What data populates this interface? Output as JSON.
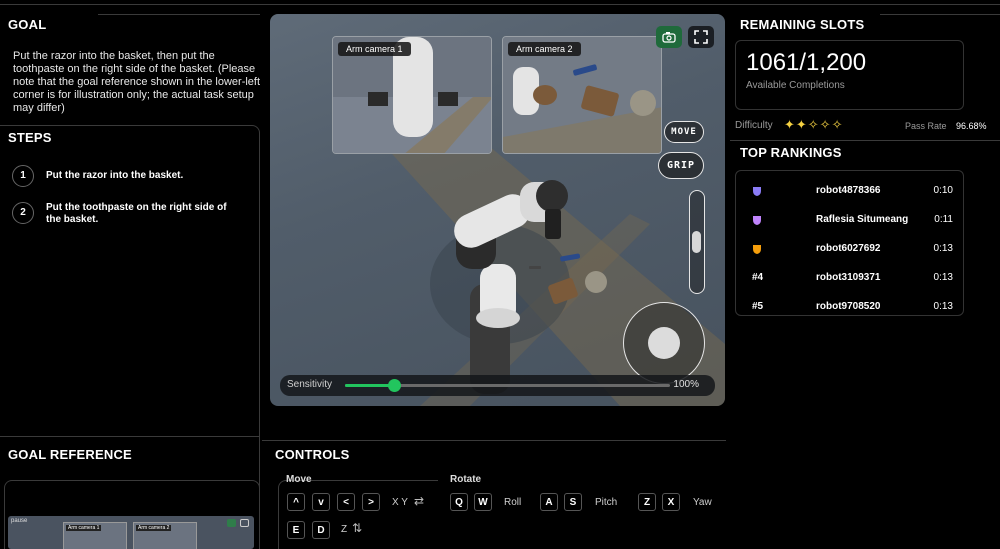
{
  "goal": {
    "heading": "GOAL",
    "text": "Put the razor into the basket, then put the toothpaste on the right side of the basket. (Please note that the goal reference shown in the lower-left corner is for illustration only; the actual task setup may differ)"
  },
  "steps": {
    "heading": "STEPS",
    "items": [
      {
        "num": "1",
        "text": "Put the razor into the basket."
      },
      {
        "num": "2",
        "text": "Put the toothpaste on the right side of the basket."
      }
    ]
  },
  "goal_reference": {
    "heading": "GOAL REFERENCE",
    "thumb_pause": "pause",
    "thumb_cam1": "Arm camera 1",
    "thumb_cam2": "Arm camera 2"
  },
  "viewport": {
    "cam1_label": "Arm camera 1",
    "cam2_label": "Arm camera 2",
    "move_label": "MOVE",
    "grip_label": "GRIP",
    "sensitivity_label": "Sensitivity",
    "sensitivity_value": "100%",
    "sensitivity_fraction": 0.15,
    "camera_icon": "camera-icon",
    "fullscreen_icon": "fullscreen-icon",
    "accent_color": "#22c55e"
  },
  "controls": {
    "heading": "CONTROLS",
    "move_title": "Move",
    "rotate_title": "Rotate",
    "move_keys": [
      "^",
      "v",
      "<",
      ">"
    ],
    "xy_label": "X Y",
    "z_keys": [
      "E",
      "D"
    ],
    "z_label": "Z",
    "roll_keys": [
      "Q",
      "W"
    ],
    "roll_label": "Roll",
    "pitch_keys": [
      "A",
      "S"
    ],
    "pitch_label": "Pitch",
    "yaw_keys": [
      "Z",
      "X"
    ],
    "yaw_label": "Yaw"
  },
  "slots": {
    "heading": "REMAINING SLOTS",
    "count": "1061/1,200",
    "caption": "Available Completions",
    "difficulty_label": "Difficulty",
    "difficulty_stars": "✦✦✧✧✧",
    "pass_rate_label": "Pass Rate",
    "pass_rate_value": "96.68%"
  },
  "rankings": {
    "heading": "TOP RANKINGS",
    "rows": [
      {
        "pos": "1",
        "name": "robot4878366",
        "time": "0:10",
        "color": "#8b7cf6"
      },
      {
        "pos": "2",
        "name": "Raflesia Situmeang",
        "time": "0:11",
        "color": "#c084fc"
      },
      {
        "pos": "3",
        "name": "robot6027692",
        "time": "0:13",
        "color": "#f59e0b"
      },
      {
        "pos": "#4",
        "name": "robot3109371",
        "time": "0:13"
      },
      {
        "pos": "#5",
        "name": "robot9708520",
        "time": "0:13"
      }
    ]
  }
}
